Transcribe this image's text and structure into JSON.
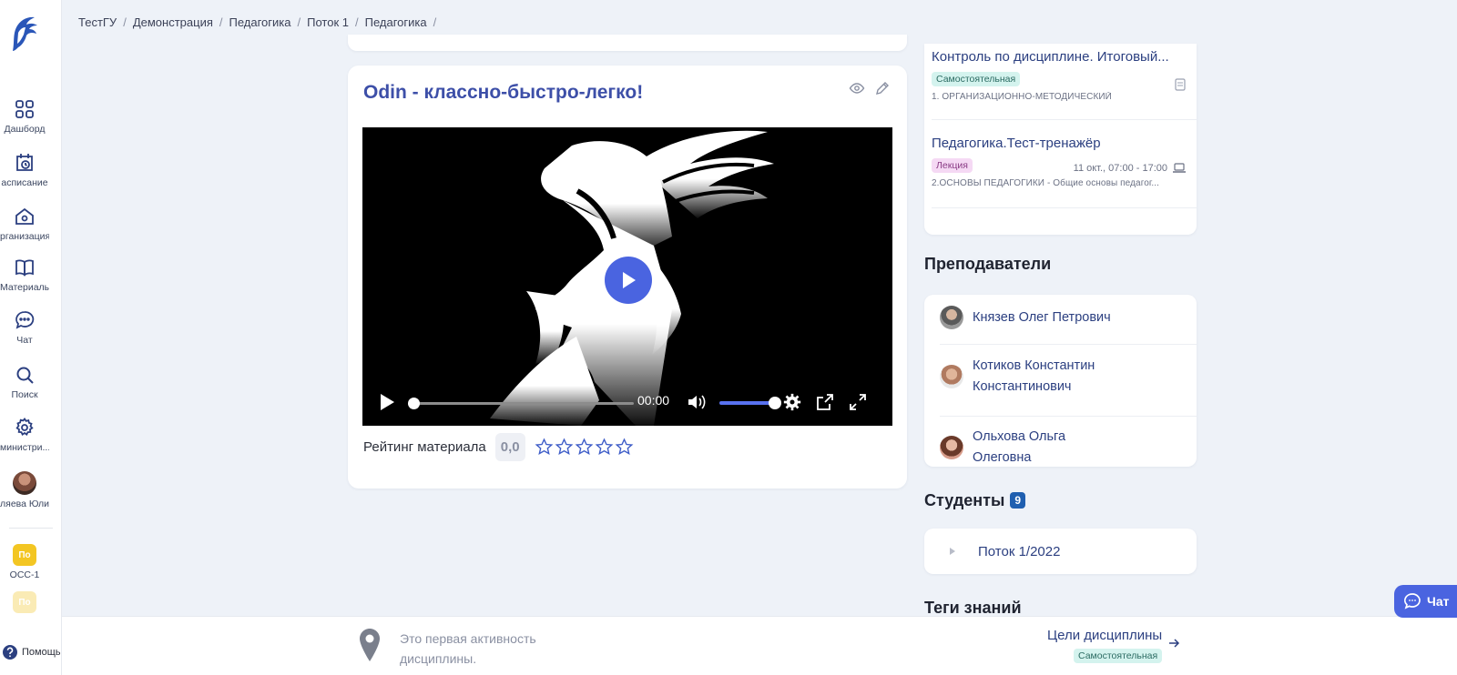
{
  "sidebar": {
    "items": [
      {
        "label": "Дашборд",
        "icon": "dashboard-grid-icon"
      },
      {
        "label": "асписание",
        "icon": "calendar-clock-icon"
      },
      {
        "label": "рганизация",
        "icon": "home-icon"
      },
      {
        "label": "Материалы",
        "icon": "book-open-icon"
      },
      {
        "label": "Чат",
        "icon": "chat-bubble-icon"
      },
      {
        "label": "Поиск",
        "icon": "search-icon"
      },
      {
        "label": "министри...",
        "icon": "gear-icon"
      },
      {
        "label": "ляева Юлия",
        "icon": "user-avatar"
      }
    ],
    "orgs": [
      {
        "badge": "По",
        "label": "ОСС-1"
      },
      {
        "badge": "По",
        "label": ""
      }
    ],
    "help_label": "Помощь"
  },
  "breadcrumb": [
    "ТестГУ",
    "Демонстрация",
    "Педагогика",
    "Поток 1",
    "Педагогика"
  ],
  "material": {
    "title": "Odin - классно-быстро-легко!",
    "video": {
      "time": "00:00",
      "progress_fraction": 0.0,
      "volume_fraction": 1.0
    },
    "rating_label": "Рейтинг материала",
    "rating_value": "0,0",
    "stars_filled": 0,
    "stars_total": 5
  },
  "activities": [
    {
      "title": "Контроль по дисциплине. Итоговый...",
      "tag": "Самостоятельная",
      "meta": "",
      "sub": "1. ОРГАНИЗАЦИОННО-МЕТОДИЧЕСКИЙ"
    },
    {
      "title": "Педагогика.Тест-тренажёр",
      "tag": "Лекция",
      "meta": "11 окт., 07:00 - 17:00",
      "sub": "2.ОСНОВЫ ПЕДАГОГИКИ - Общие основы педагог..."
    }
  ],
  "teachers_title": "Преподаватели",
  "teachers": [
    {
      "name": "Князев Олег Петрович"
    },
    {
      "name": "Котиков Константин Константинович"
    },
    {
      "name": "Ольхова Ольга Олеговна"
    }
  ],
  "students": {
    "title": "Студенты",
    "count": "9",
    "stream": "Поток 1/2022"
  },
  "tags_title": "Теги знаний",
  "footer": {
    "first_activity": "Это первая активность дисциплины.",
    "goals_label": "Цели дисциплины",
    "goals_tag": "Самостоятельная"
  },
  "chat_button": "Чат",
  "colors": {
    "accent": "#4a64e0",
    "title_blue": "#3d4fa8",
    "link_blue": "#2b3f80",
    "badge_blue": "#1f5fb0",
    "org_yellow": "#f3c623",
    "background": "#eef2f8"
  }
}
